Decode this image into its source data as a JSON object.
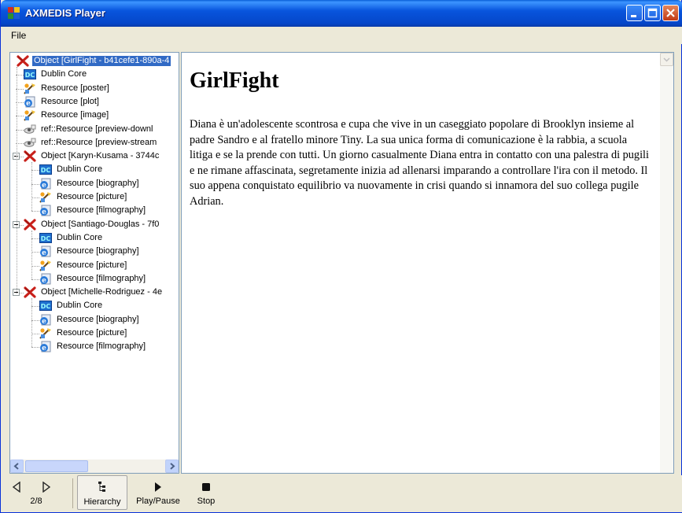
{
  "window": {
    "title": "AXMEDIS Player"
  },
  "menu": {
    "file": "File"
  },
  "tree": [
    {
      "label": "Object [GirlFight - b41cefe1-890a-4",
      "icon": "axmedis-object-icon",
      "selected": true
    },
    {
      "label": "Dublin Core",
      "icon": "dublin-core-icon"
    },
    {
      "label": "Resource [poster]",
      "icon": "image-resource-icon"
    },
    {
      "label": "Resource [plot]",
      "icon": "html-resource-icon"
    },
    {
      "label": "Resource [image]",
      "icon": "image-resource-icon"
    },
    {
      "label": "ref::Resource [preview-downl",
      "icon": "reference-resource-icon"
    },
    {
      "label": "ref::Resource [preview-stream",
      "icon": "reference-resource-icon"
    },
    {
      "label": "Object [Karyn-Kusama - 3744c",
      "icon": "axmedis-object-icon"
    },
    {
      "label": "Dublin Core",
      "icon": "dublin-core-icon"
    },
    {
      "label": "Resource [biography]",
      "icon": "html-resource-icon"
    },
    {
      "label": "Resource [picture]",
      "icon": "image-resource-icon"
    },
    {
      "label": "Resource [filmography]",
      "icon": "html-resource-icon"
    },
    {
      "label": "Object [Santiago-Douglas - 7f0",
      "icon": "axmedis-object-icon"
    },
    {
      "label": "Dublin Core",
      "icon": "dublin-core-icon"
    },
    {
      "label": "Resource [biography]",
      "icon": "html-resource-icon"
    },
    {
      "label": "Resource [picture]",
      "icon": "image-resource-icon"
    },
    {
      "label": "Resource [filmography]",
      "icon": "html-resource-icon"
    },
    {
      "label": "Object [Michelle-Rodriguez - 4e",
      "icon": "axmedis-object-icon"
    },
    {
      "label": "Dublin Core",
      "icon": "dublin-core-icon"
    },
    {
      "label": "Resource [biography]",
      "icon": "html-resource-icon"
    },
    {
      "label": "Resource [picture]",
      "icon": "image-resource-icon"
    },
    {
      "label": "Resource [filmography]",
      "icon": "html-resource-icon"
    }
  ],
  "content": {
    "title": "GirlFight",
    "body": "Diana è un'adolescente scontrosa e cupa che vive in un caseggiato popolare di Brooklyn insieme al padre Sandro e al fratello minore Tiny. La sua unica forma di comunicazione è la rabbia, a scuola litiga e se la prende con tutti. Un giorno casualmente Diana entra in contatto con una palestra di pugili e ne rimane affascinata, segretamente inizia ad allenarsi imparando a controllare l'ira con il metodo. Il suo appena conquistato equilibrio va nuovamente in crisi quando si innamora del suo collega pugile Adrian."
  },
  "toolbar": {
    "page": "2/8",
    "hierarchy": "Hierarchy",
    "play_pause": "Play/Pause",
    "stop": "Stop"
  }
}
